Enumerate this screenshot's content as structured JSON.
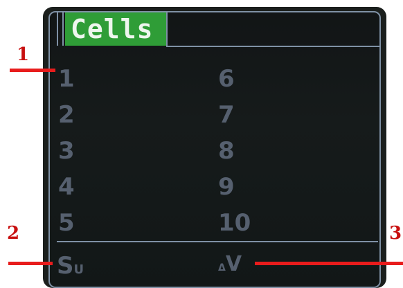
{
  "screen": {
    "tab_title": "Cells"
  },
  "cells": {
    "left": [
      "1",
      "2",
      "3",
      "4",
      "5"
    ],
    "right": [
      "6",
      "7",
      "8",
      "9",
      "10"
    ]
  },
  "footer": {
    "sum_label_main": "S",
    "sum_label_sub": "U",
    "delta_label_prefix": "Δ",
    "delta_label_main": "V"
  },
  "callouts": [
    "1",
    "2",
    "3"
  ],
  "colors": {
    "screen_bg": "#121516",
    "frame": "#7f91a5",
    "tab_bg": "#2f9d37",
    "label_text": "#56606f",
    "callout_red": "#e81c1c"
  }
}
